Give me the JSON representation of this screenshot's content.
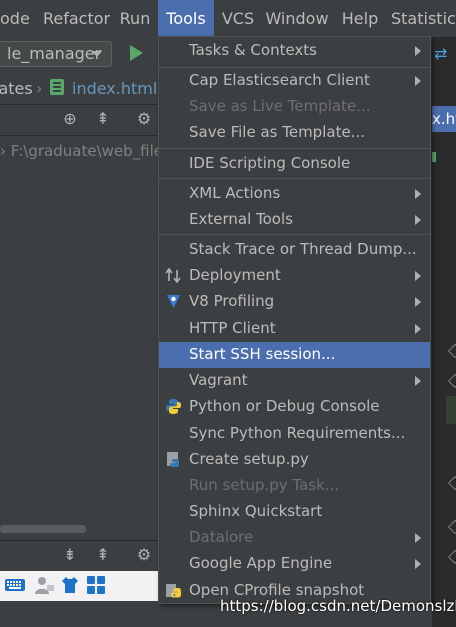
{
  "menubar": {
    "items": [
      {
        "label": "ode",
        "active": false
      },
      {
        "label": "Refactor",
        "active": false
      },
      {
        "label": "Run",
        "active": false
      },
      {
        "label": "Tools",
        "active": true
      },
      {
        "label": "VCS",
        "active": false
      },
      {
        "label": "Window",
        "active": false
      },
      {
        "label": "Help",
        "active": false
      },
      {
        "label": "Statistics",
        "active": false
      }
    ]
  },
  "toolbar": {
    "run_config": "le_manager"
  },
  "breadcrumb": {
    "parent": "lates",
    "file": "index.html"
  },
  "project_tree": {
    "root_path": "F:\\graduate\\web_file"
  },
  "editor": {
    "tab_label": "x.htm"
  },
  "tools_menu": {
    "items": [
      {
        "label": "Tasks & Contexts",
        "submenu": true,
        "disabled": false
      },
      {
        "label": "Cap Elasticsearch Client",
        "submenu": true,
        "disabled": false
      },
      {
        "label": "Save as Live Template...",
        "submenu": false,
        "disabled": true
      },
      {
        "label": "Save File as Template...",
        "submenu": false,
        "disabled": false
      },
      {
        "label": "IDE Scripting Console",
        "submenu": false,
        "disabled": false
      },
      {
        "label": "XML Actions",
        "submenu": true,
        "disabled": false
      },
      {
        "label": "External Tools",
        "submenu": true,
        "disabled": false
      },
      {
        "label": "Stack Trace or Thread Dump...",
        "submenu": false,
        "disabled": false
      },
      {
        "label": "Deployment",
        "submenu": true,
        "disabled": false,
        "icon": "deployment-icon"
      },
      {
        "label": "V8 Profiling",
        "submenu": true,
        "disabled": false,
        "icon": "v8-icon"
      },
      {
        "label": "HTTP Client",
        "submenu": true,
        "disabled": false
      },
      {
        "label": "Start SSH session...",
        "submenu": false,
        "disabled": false,
        "selected": true
      },
      {
        "label": "Vagrant",
        "submenu": true,
        "disabled": false
      },
      {
        "label": "Python or Debug Console",
        "submenu": false,
        "disabled": false,
        "icon": "python-icon"
      },
      {
        "label": "Sync Python Requirements...",
        "submenu": false,
        "disabled": false
      },
      {
        "label": "Create setup.py",
        "submenu": false,
        "disabled": false,
        "icon": "setup-py-icon"
      },
      {
        "label": "Run setup.py Task...",
        "submenu": false,
        "disabled": true
      },
      {
        "label": "Sphinx Quickstart",
        "submenu": false,
        "disabled": false
      },
      {
        "label": "Datalore",
        "submenu": true,
        "disabled": true
      },
      {
        "label": "Google App Engine",
        "submenu": true,
        "disabled": false
      },
      {
        "label": "Open CProfile snapshot",
        "submenu": false,
        "disabled": false,
        "icon": "cprofile-icon"
      }
    ]
  },
  "watermark": "https://blog.csdn.net/Demonslzh",
  "colors": {
    "accent": "#4b6eaf",
    "background": "#3c3f41",
    "text": "#bbbbbb",
    "disabled": "#6e6e6e",
    "run_green": "#59a869"
  }
}
